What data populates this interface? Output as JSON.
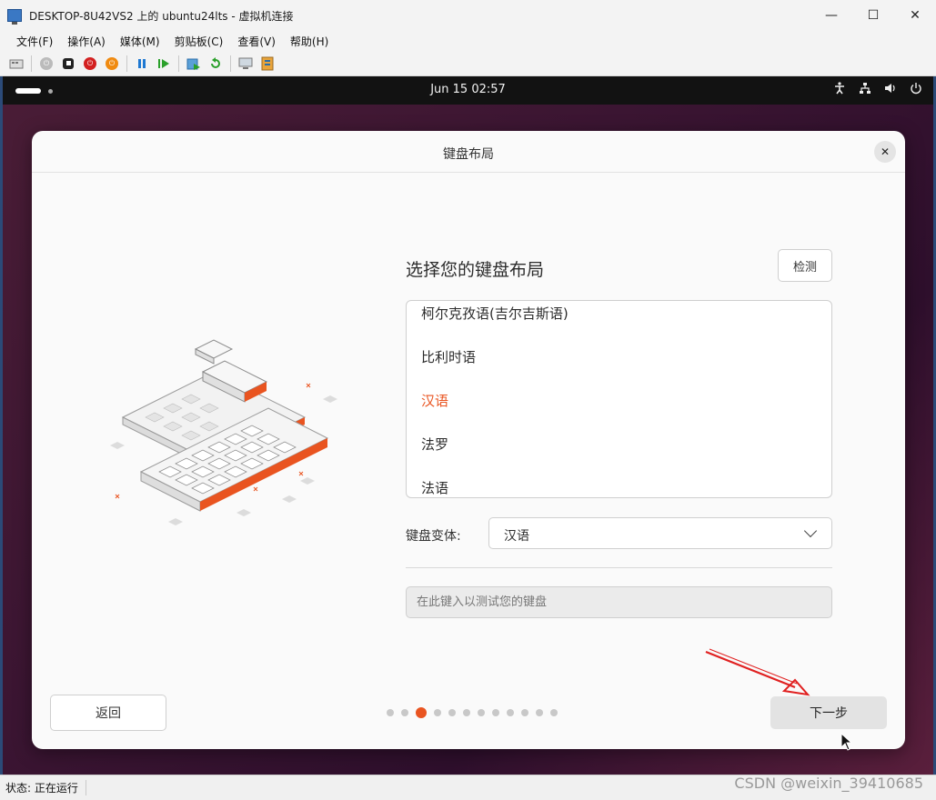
{
  "window": {
    "title": "DESKTOP-8U42VS2 上的 ubuntu24lts - 虚拟机连接",
    "controls": {
      "minimize": "—",
      "maximize": "☐",
      "close": "✕"
    }
  },
  "menubar": {
    "items": [
      "文件(F)",
      "操作(A)",
      "媒体(M)",
      "剪贴板(C)",
      "查看(V)",
      "帮助(H)"
    ]
  },
  "vm_topbar": {
    "clock": "Jun 15  02:57",
    "tray_icons": [
      "accessibility-icon",
      "network-icon",
      "volume-icon",
      "power-icon"
    ]
  },
  "dialog": {
    "title": "键盘布局",
    "heading": "选择您的键盘布局",
    "detect_label": "检测",
    "layouts": [
      {
        "label": "柯尔克孜语(吉尔吉斯语)",
        "selected": false
      },
      {
        "label": "比利时语",
        "selected": false
      },
      {
        "label": "汉语",
        "selected": true
      },
      {
        "label": "法罗",
        "selected": false
      },
      {
        "label": "法语",
        "selected": false
      }
    ],
    "variant_label": "键盘变体:",
    "variant_value": "汉语",
    "test_placeholder": "在此键入以测试您的键盘",
    "back_label": "返回",
    "next_label": "下一步",
    "steps": {
      "total": 12,
      "current": 3
    }
  },
  "statusbar": {
    "text": "状态: 正在运行"
  },
  "watermark": "CSDN @weixin_39410685",
  "colors": {
    "accent": "#e95420",
    "annotation": "#e02020"
  }
}
